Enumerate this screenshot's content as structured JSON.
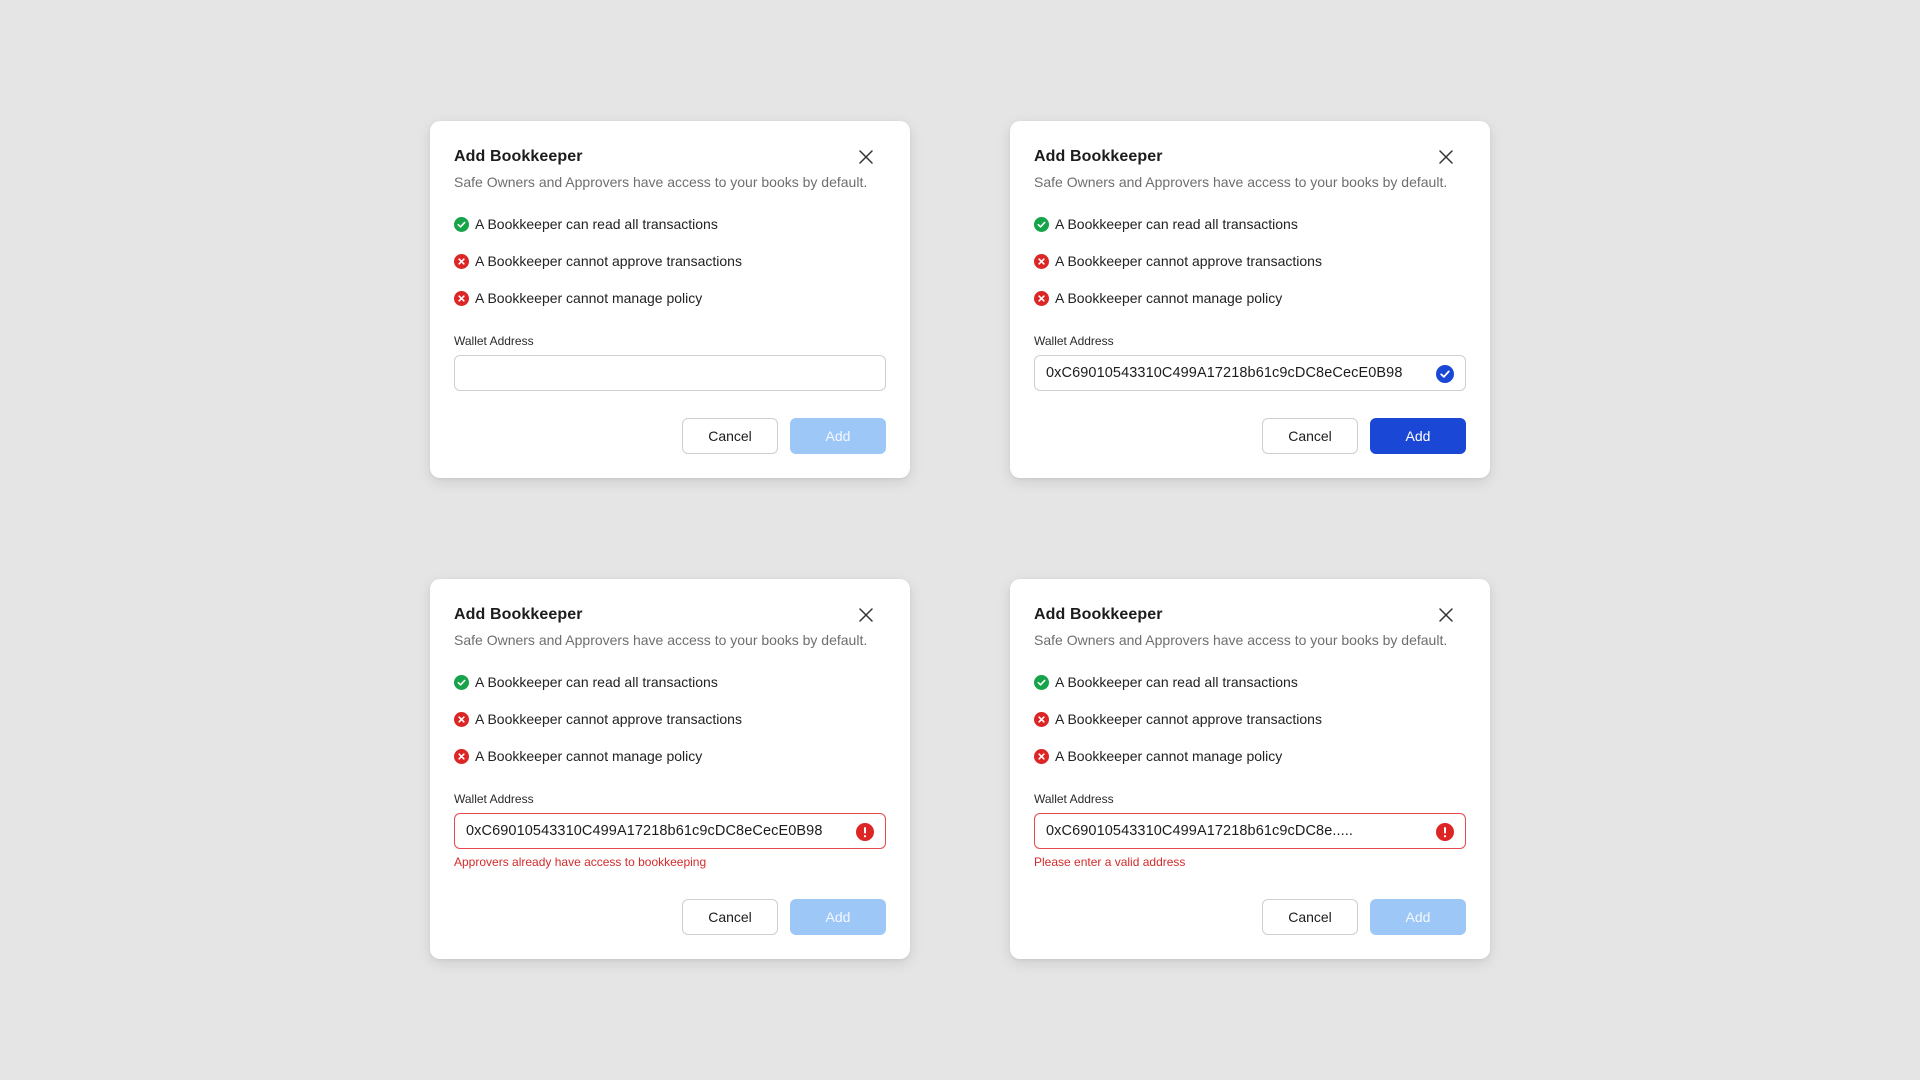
{
  "colors": {
    "background": "#e5e5e5",
    "success": "#16a34a",
    "danger": "#dc2626",
    "primary": "#1a47d6",
    "primary_disabled": "#9cc7f7",
    "error_border": "#e5484d"
  },
  "dialogs": [
    {
      "title": "Add Bookkeeper",
      "subtitle": "Safe Owners and Approvers have access to your books by default.",
      "permissions": [
        {
          "label": "A Bookkeeper can read all transactions",
          "icon": "check-circle-icon"
        },
        {
          "label": "A Bookkeeper cannot approve transactions",
          "icon": "x-circle-icon"
        },
        {
          "label": "A Bookkeeper cannot manage policy",
          "icon": "x-circle-icon"
        }
      ],
      "wallet_label": "Wallet Address",
      "wallet_value": "",
      "wallet_placeholder": "",
      "state": "empty",
      "error_message": "",
      "cancel_label": "Cancel",
      "add_label": "Add",
      "add_enabled": false
    },
    {
      "title": "Add Bookkeeper",
      "subtitle": "Safe Owners and Approvers have access to your books by default.",
      "permissions": [
        {
          "label": "A Bookkeeper can read all transactions",
          "icon": "check-circle-icon"
        },
        {
          "label": "A Bookkeeper cannot approve transactions",
          "icon": "x-circle-icon"
        },
        {
          "label": "A Bookkeeper cannot manage policy",
          "icon": "x-circle-icon"
        }
      ],
      "wallet_label": "Wallet Address",
      "wallet_value": "0xC69010543310C499A17218b61c9cDC8eCecE0B98",
      "wallet_placeholder": "",
      "state": "valid",
      "error_message": "",
      "cancel_label": "Cancel",
      "add_label": "Add",
      "add_enabled": true
    },
    {
      "title": "Add Bookkeeper",
      "subtitle": "Safe Owners and Approvers have access to your books by default.",
      "permissions": [
        {
          "label": "A Bookkeeper can read all transactions",
          "icon": "check-circle-icon"
        },
        {
          "label": "A Bookkeeper cannot approve transactions",
          "icon": "x-circle-icon"
        },
        {
          "label": "A Bookkeeper cannot manage policy",
          "icon": "x-circle-icon"
        }
      ],
      "wallet_label": "Wallet Address",
      "wallet_value": "0xC69010543310C499A17218b61c9cDC8eCecE0B98",
      "wallet_placeholder": "",
      "state": "error",
      "error_message": "Approvers already have access to bookkeeping",
      "cancel_label": "Cancel",
      "add_label": "Add",
      "add_enabled": false
    },
    {
      "title": "Add Bookkeeper",
      "subtitle": "Safe Owners and Approvers have access to your books by default.",
      "permissions": [
        {
          "label": "A Bookkeeper can read all transactions",
          "icon": "check-circle-icon"
        },
        {
          "label": "A Bookkeeper cannot approve transactions",
          "icon": "x-circle-icon"
        },
        {
          "label": "A Bookkeeper cannot manage policy",
          "icon": "x-circle-icon"
        }
      ],
      "wallet_label": "Wallet Address",
      "wallet_value": "0xC69010543310C499A17218b61c9cDC8e.....",
      "wallet_placeholder": "",
      "state": "error",
      "error_message": "Please enter a valid address",
      "cancel_label": "Cancel",
      "add_label": "Add",
      "add_enabled": false
    }
  ]
}
